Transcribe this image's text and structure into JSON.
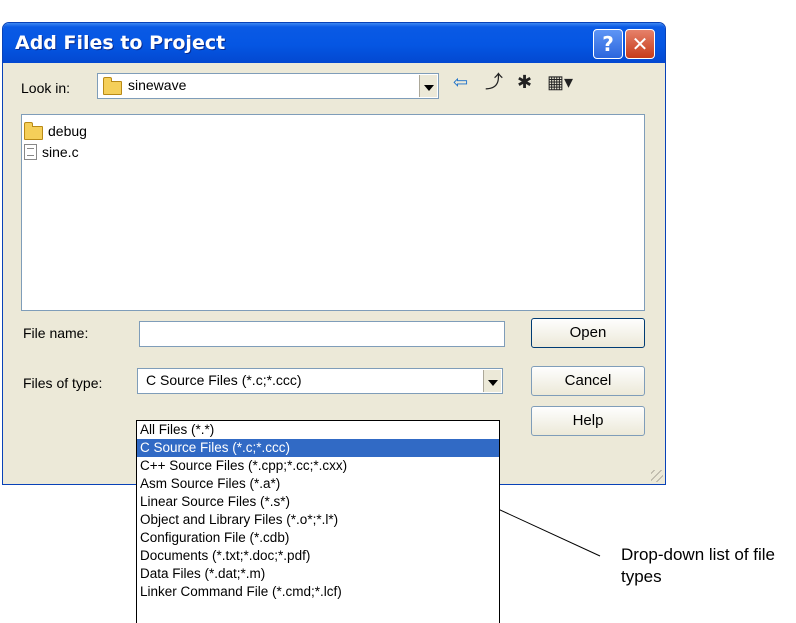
{
  "dialog": {
    "title": "Add Files to Project",
    "help_glyph": "?",
    "close_glyph": "✕"
  },
  "look_in": {
    "label": "Look in:",
    "value": "sinewave"
  },
  "toolbar": {
    "back_glyph": "⇦",
    "up_glyph": "⤴",
    "new_folder_glyph": "✱",
    "view_glyph": "▦▾"
  },
  "files": [
    {
      "name": "debug",
      "icon": "folder-icon"
    },
    {
      "name": "sine.c",
      "icon": "file-icon"
    }
  ],
  "file_name": {
    "label": "File name:",
    "value": ""
  },
  "files_of_type": {
    "label": "Files of type:",
    "value": "C Source Files (*.c;*.ccc)",
    "options": [
      "All Files (*.*)",
      "C Source Files (*.c;*.ccc)",
      "C++ Source Files (*.cpp;*.cc;*.cxx)",
      "Asm Source Files (*.a*)",
      "Linear Source Files (*.s*)",
      "Object and Library Files (*.o*;*.l*)",
      "Configuration File (*.cdb)",
      "Documents (*.txt;*.doc;*.pdf)",
      "Data Files (*.dat;*.m)",
      "Linker Command File (*.cmd;*.lcf)"
    ],
    "selected_index": 1
  },
  "buttons": {
    "open": "Open",
    "cancel": "Cancel",
    "help": "Help"
  },
  "annotation": "Drop-down list of file types",
  "colors": {
    "titlebar": "#0556e3",
    "selection": "#316ac5",
    "dialog_bg": "#ece9d8"
  }
}
